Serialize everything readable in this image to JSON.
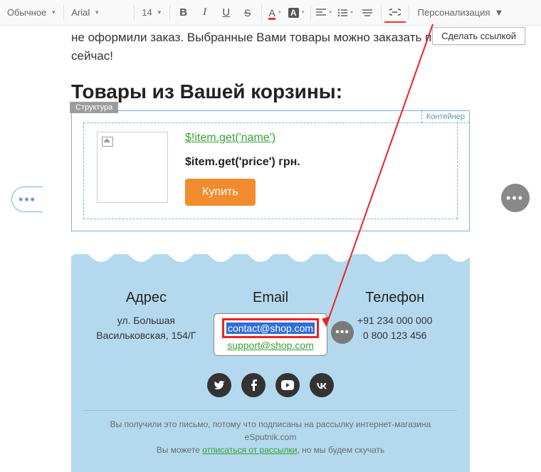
{
  "toolbar": {
    "style_select": "Обычное",
    "font_select": "Arial",
    "size_select": "14",
    "bold": "B",
    "italic": "I",
    "underline": "U",
    "strike": "S",
    "text_color_letter": "A",
    "bg_color_letter": "A",
    "personalization": "Персонализация"
  },
  "tooltip": "Сделать ссылкой",
  "content": {
    "body_text": "не оформили заказ. Выбранные Вами товары можно заказать прямо сейчас!",
    "cart_heading": "Товары из Вашей корзины:",
    "structure_label": "Структура",
    "container_label": "Контейнер",
    "item_name": "$!item.get('name')",
    "item_price": "$item.get('price') грн.",
    "buy_label": "Купить"
  },
  "footer": {
    "address_title": "Адрес",
    "address_line1": "ул. Большая",
    "address_line2": "Васильковская, 154/Г",
    "email_title": "Email",
    "email_contact": "contact@shop.com",
    "email_support": "support@shop.com",
    "phone_title": "Телефон",
    "phone_line1": "+91 234 000 000",
    "phone_line2": "0 800 123 456",
    "note_line1": "Вы получили это письмо, потому что подписаны на рассылку интернет-магазина eSputnik.com",
    "note_prefix": "Вы можете ",
    "note_link": "отписаться от рассылки",
    "note_suffix": ", но мы будем скучать"
  }
}
